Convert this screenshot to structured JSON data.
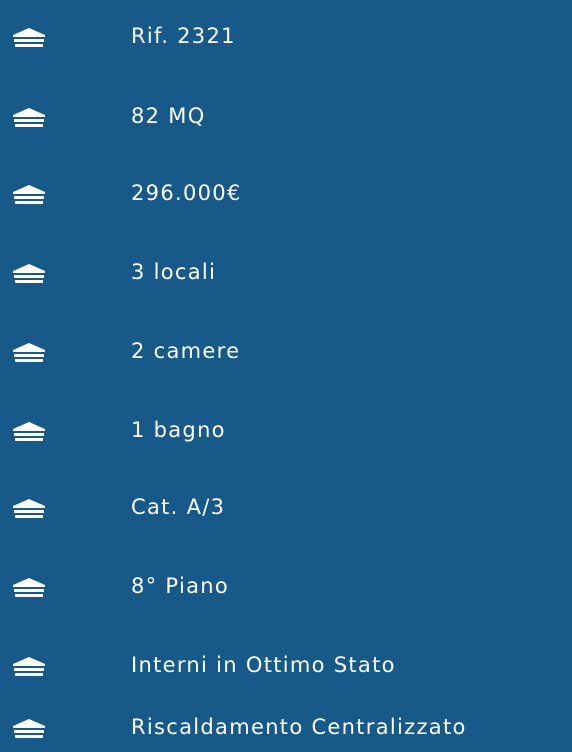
{
  "colors": {
    "background": "#175a89",
    "foreground": "#ffffff"
  },
  "features": {
    "icon": "house-outline-icon",
    "items": [
      {
        "label": "Rif. 2321"
      },
      {
        "label": "82 MQ"
      },
      {
        "label": "296.000€"
      },
      {
        "label": "3 locali"
      },
      {
        "label": "2 camere"
      },
      {
        "label": "1 bagno"
      },
      {
        "label": "Cat. A/3"
      },
      {
        "label": "8° Piano"
      },
      {
        "label": "Interni in Ottimo Stato"
      },
      {
        "label": "Riscaldamento Centralizzato"
      }
    ]
  }
}
